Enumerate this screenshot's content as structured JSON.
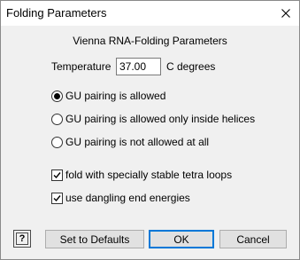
{
  "window": {
    "title": "Folding Parameters"
  },
  "icons": {
    "close": "close-icon",
    "help": "help-icon",
    "check": "checkmark-icon"
  },
  "colors": {
    "default_button_border": "#0078d7",
    "dialog_background": "#f0f0f0"
  },
  "dialog": {
    "heading": "Vienna RNA-Folding Parameters",
    "temperature": {
      "label": "Temperature",
      "value": "37.00",
      "unit": "C degrees"
    },
    "gu_options": [
      {
        "label": "GU pairing is allowed",
        "selected": true
      },
      {
        "label": "GU pairing is allowed only inside helices",
        "selected": false
      },
      {
        "label": "GU pairing is not allowed at all",
        "selected": false
      }
    ],
    "checkboxes": [
      {
        "label": "fold with specially stable tetra loops",
        "checked": true
      },
      {
        "label": "use dangling end energies",
        "checked": true
      }
    ]
  },
  "buttons": {
    "help_label": "?",
    "defaults_label": "Set to Defaults",
    "ok_label": "OK",
    "cancel_label": "Cancel"
  }
}
